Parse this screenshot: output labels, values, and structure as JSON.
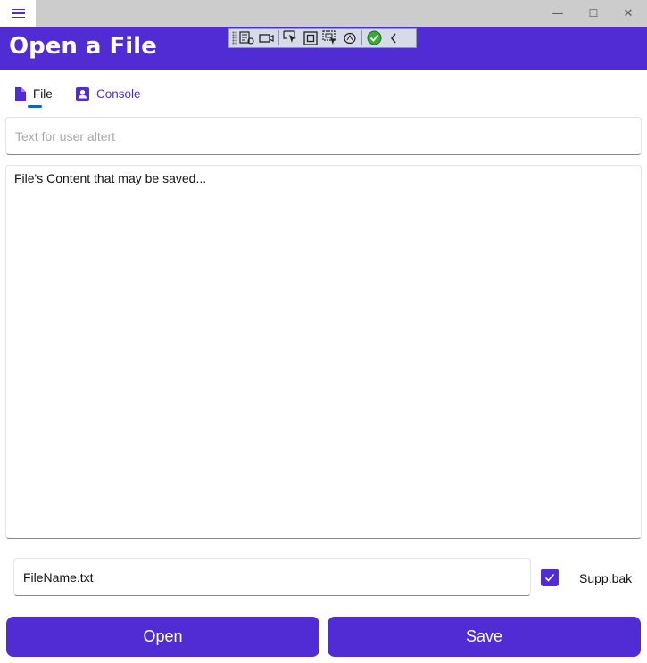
{
  "window": {
    "minimize_glyph": "—",
    "maximize_glyph": "☐",
    "close_glyph": "✕"
  },
  "header": {
    "title": "Open a File",
    "background": "#512bd4"
  },
  "devtools": {
    "icons": [
      "live-visual-tree-icon",
      "record-icon",
      "select-element-icon",
      "display-adorners-icon",
      "track-focus-icon",
      "binding-failures-icon",
      "accessibility-check-icon",
      "collapse-chevron-icon"
    ]
  },
  "tabs": [
    {
      "label": "File",
      "icon": "document-icon",
      "selected": true
    },
    {
      "label": "Console",
      "icon": "contact-card-icon",
      "selected": false
    }
  ],
  "alert_field": {
    "placeholder": "Text for user altert",
    "value": ""
  },
  "content_field": {
    "value": "File's Content that may be saved..."
  },
  "filename_field": {
    "value": "FileName.txt"
  },
  "backup_checkbox": {
    "label": "Supp.bak",
    "checked": true
  },
  "buttons": {
    "open_label": "Open",
    "save_label": "Save"
  },
  "colors": {
    "accent": "#512bd4",
    "tab_indicator": "#0b66b8",
    "titlebar": "#cccccc"
  }
}
